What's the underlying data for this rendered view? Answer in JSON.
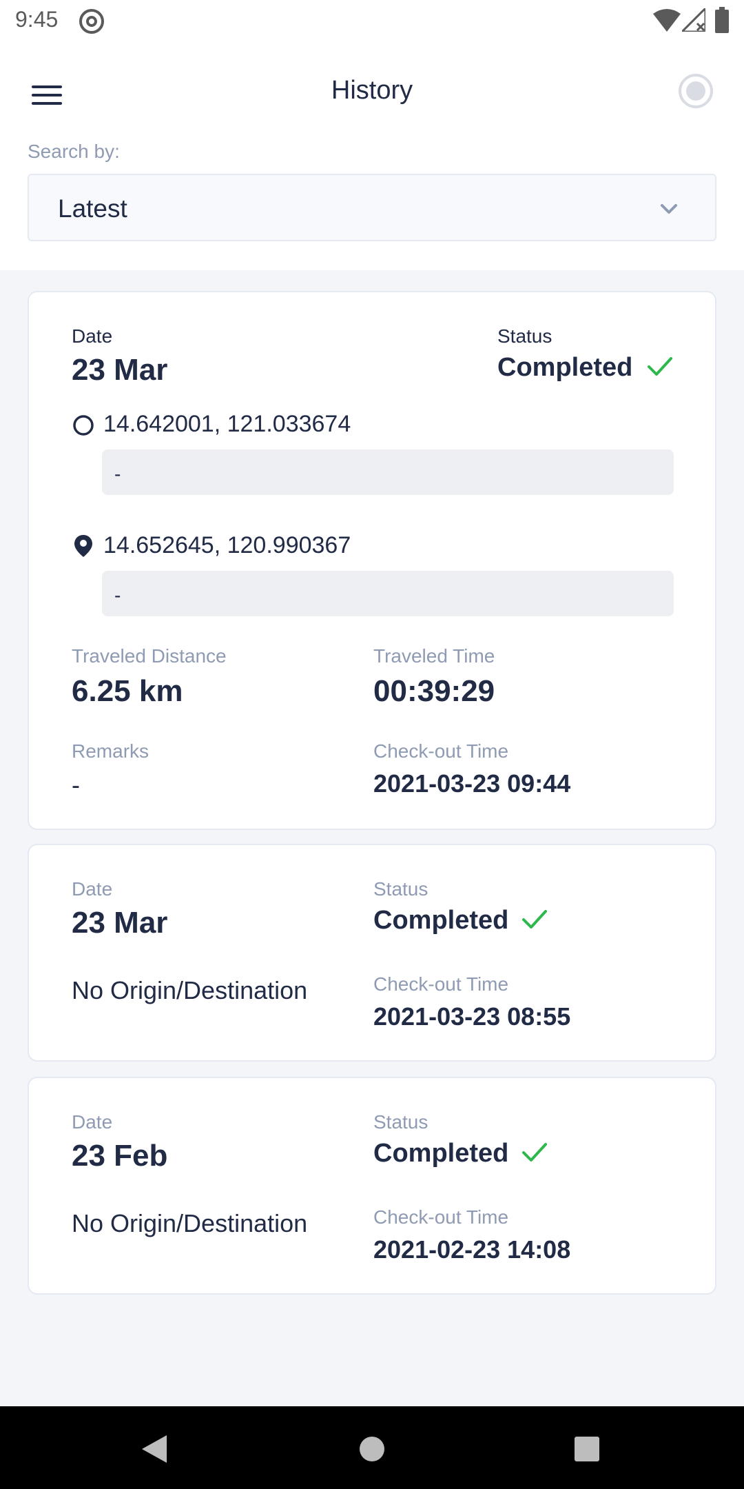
{
  "status_bar": {
    "time": "9:45"
  },
  "header": {
    "title": "History"
  },
  "search": {
    "label": "Search by:",
    "selected": "Latest"
  },
  "colors": {
    "accent_check": "#2DB84C",
    "text_dark": "#222B45",
    "text_muted": "#8F9BB3"
  },
  "cards": [
    {
      "date_label": "Date",
      "date": "23 Mar",
      "status_label": "Status",
      "status": "Completed",
      "origin": "14.642001, 121.033674",
      "origin_address": "-",
      "destination": "14.652645, 120.990367",
      "destination_address": "-",
      "distance_label": "Traveled Distance",
      "distance": "6.25 km",
      "time_label": "Traveled Time",
      "time": "00:39:29",
      "remarks_label": "Remarks",
      "remarks": "-",
      "checkout_label": "Check-out Time",
      "checkout": "2021-03-23 09:44"
    },
    {
      "date_label": "Date",
      "date": "23 Mar",
      "status_label": "Status",
      "status": "Completed",
      "origin_destination": "No Origin/Destination",
      "checkout_label": "Check-out Time",
      "checkout": "2021-03-23 08:55"
    },
    {
      "date_label": "Date",
      "date": "23 Feb",
      "status_label": "Status",
      "status": "Completed",
      "origin_destination": "No Origin/Destination",
      "checkout_label": "Check-out Time",
      "checkout": "2021-02-23 14:08"
    }
  ]
}
